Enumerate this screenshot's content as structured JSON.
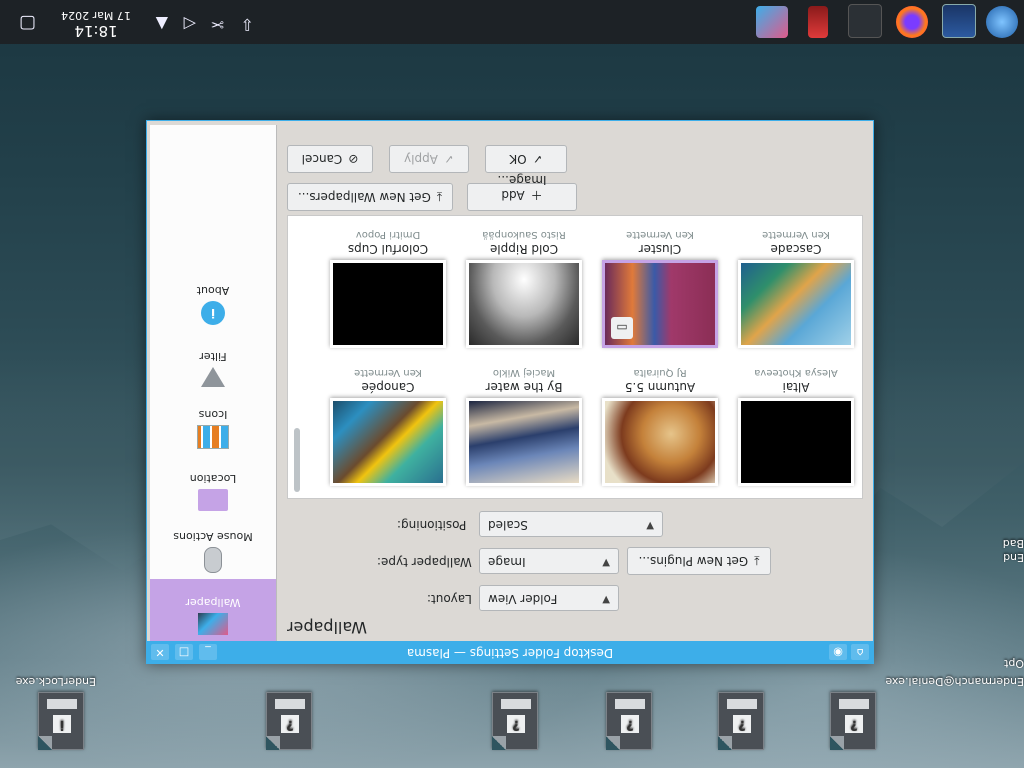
{
  "desktop": {
    "icons": [
      {
        "label": "EnderLock.exe"
      },
      {
        "label": ""
      },
      {
        "label": ""
      },
      {
        "label": ""
      },
      {
        "label": ""
      },
      {
        "label": "Endermanch@Denial.exe"
      }
    ],
    "partial_labels": {
      "top": "Opt",
      "mid": "Bad",
      "low": "End"
    }
  },
  "window": {
    "title": "Desktop Folder Settings — Plasma",
    "heading": "Wallpaper",
    "sidebar": [
      {
        "label": "Wallpaper",
        "icon": "wallpaper-icon",
        "selected": true
      },
      {
        "label": "Mouse Actions",
        "icon": "mouse-icon"
      },
      {
        "label": "Location",
        "icon": "folder-icon"
      },
      {
        "label": "Icons",
        "icon": "icons-icon"
      },
      {
        "label": "Filter",
        "icon": "filter-icon"
      },
      {
        "label": "About",
        "icon": "info-icon"
      }
    ],
    "form": {
      "layout_label": "Layout:",
      "layout_value": "Folder View",
      "type_label": "Wallpaper type:",
      "type_value": "Image",
      "plugins_button": "Get New Plugins...",
      "positioning_label": "Positioning:",
      "positioning_value": "Scaled"
    },
    "wallpapers": [
      {
        "name": "Altai",
        "author": "Alesya Khoteeva"
      },
      {
        "name": "Autumn 5.5",
        "author": "RJ Quiralta"
      },
      {
        "name": "By the water",
        "author": "Maciej Wiklo"
      },
      {
        "name": "Canopée",
        "author": "Ken Vermette"
      },
      {
        "name": "Cascade",
        "author": "Ken Vermette"
      },
      {
        "name": "Cluster",
        "author": "Ken Vermette"
      },
      {
        "name": "Cold Ripple",
        "author": "Risto Saukonpää"
      },
      {
        "name": "Colorful Cups",
        "author": "Dmitri Popov"
      }
    ],
    "buttons": {
      "add_image": "Add Image...",
      "get_new": "Get New Wallpapers...",
      "ok": "OK",
      "apply": "Apply",
      "cancel": "Cancel"
    }
  },
  "taskbar": {
    "time": "18:14",
    "date": "17 Mar 2024"
  }
}
